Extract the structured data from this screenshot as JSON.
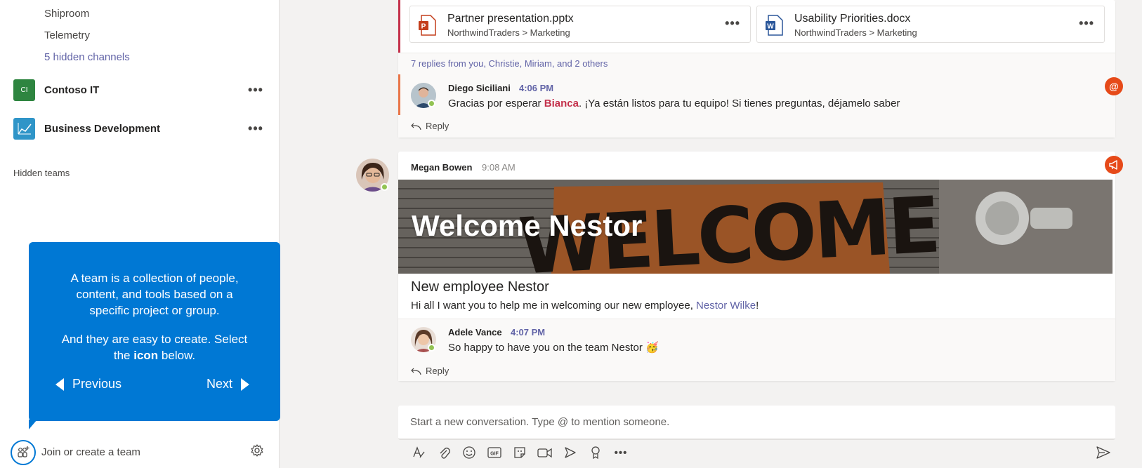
{
  "sidebar": {
    "channels": [
      "Shiproom",
      "Telemetry"
    ],
    "hidden_channels": "5 hidden channels",
    "teams": [
      {
        "initials": "CI",
        "name": "Contoso IT",
        "color": "#2e8540"
      },
      {
        "initials": "",
        "name": "Business Development",
        "color": "#2f95c8"
      }
    ],
    "team_more": "•••",
    "hidden_teams": "Hidden teams",
    "join_label": "Join or create a team"
  },
  "tip": {
    "line1": "A team is a collection of people, content, and tools based on a specific project or group.",
    "line2_pre": "And they are easy to create. Select the",
    "line2_bold": "icon",
    "line2_post": "below.",
    "previous": "Previous",
    "next": "Next"
  },
  "thread1": {
    "files": [
      {
        "name": "Partner presentation.pptx",
        "path": "NorthwindTraders > Marketing",
        "type": "pptx",
        "color": "#c43e1c",
        "letter": "P"
      },
      {
        "name": "Usability Priorities.docx",
        "path": "NorthwindTraders > Marketing",
        "type": "docx",
        "color": "#2b579a",
        "letter": "W"
      }
    ],
    "file_more": "•••",
    "replies_summary": "7 replies from you, Christie, Miriam, and 2 others",
    "reply": {
      "author": "Diego Siciliani",
      "time": "4:06 PM",
      "text_pre": "Gracias por esperar",
      "mention": "Bianca",
      "text_post": ". ¡Ya están listos para tu equipo! Si tienes preguntas, déjamelo saber"
    },
    "reply_label": "Reply",
    "badge": "@"
  },
  "thread2": {
    "author": "Megan Bowen",
    "time": "9:08 AM",
    "banner_title": "Welcome Nestor",
    "banner_mat_text": "WELCOME",
    "title": "New employee Nestor",
    "text_pre": "Hi all I want you to help me in welcoming our new employee,",
    "link": "Nestor Wilke",
    "text_post": "!",
    "reply": {
      "author": "Adele Vance",
      "time": "4:07 PM",
      "text": "So happy to have you on the team Nestor",
      "emoji": "🥳"
    },
    "reply_label": "Reply"
  },
  "compose": {
    "placeholder": "Start a new conversation. Type @ to mention someone.",
    "tools": [
      "format-icon",
      "attach-icon",
      "emoji-icon",
      "gif-icon",
      "sticker-icon",
      "meet-icon",
      "stream-icon",
      "praise-icon",
      "more-icon"
    ],
    "gif_label": "GIF"
  },
  "colors": {
    "accent": "#6264a7",
    "tip_blue": "#0078d4",
    "mention_red": "#c4314b"
  }
}
